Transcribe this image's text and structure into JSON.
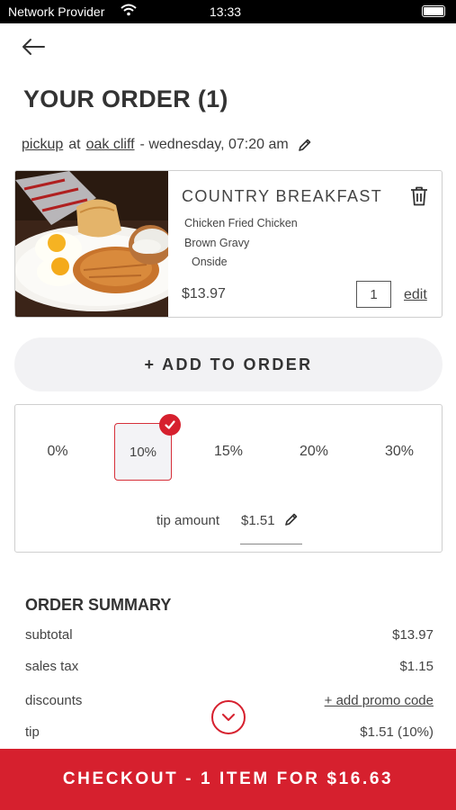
{
  "status_bar": {
    "carrier": "Network Provider",
    "time": "13:33"
  },
  "header": {
    "title": "YOUR ORDER (1)"
  },
  "pickup": {
    "mode": "pickup",
    "at": "at",
    "location": "oak cliff",
    "when": "- wednesday, 07:20 am"
  },
  "item": {
    "name": "COUNTRY BREAKFAST",
    "modifiers": [
      "Chicken Fried Chicken",
      "Brown Gravy",
      "Onside"
    ],
    "price": "$13.97",
    "quantity": "1",
    "edit_label": "edit"
  },
  "add_to_order_label": "+ ADD TO ORDER",
  "tip": {
    "options": [
      "0%",
      "10%",
      "15%",
      "20%",
      "30%"
    ],
    "selected": "10%",
    "amount_label": "tip amount",
    "amount_value": "$1.51"
  },
  "summary": {
    "title": "ORDER SUMMARY",
    "rows": [
      {
        "label": "subtotal",
        "value": "$13.97"
      },
      {
        "label": "sales tax",
        "value": "$1.15"
      },
      {
        "label": "discounts",
        "value": "+ add promo code"
      },
      {
        "label": "tip",
        "value": "$1.51 (10%)"
      }
    ]
  },
  "checkout_label": "CHECKOUT - 1 ITEM FOR $16.63",
  "colors": {
    "accent": "#d6202e",
    "button_bg": "#f2f2f4",
    "border": "#cfcfcf"
  }
}
